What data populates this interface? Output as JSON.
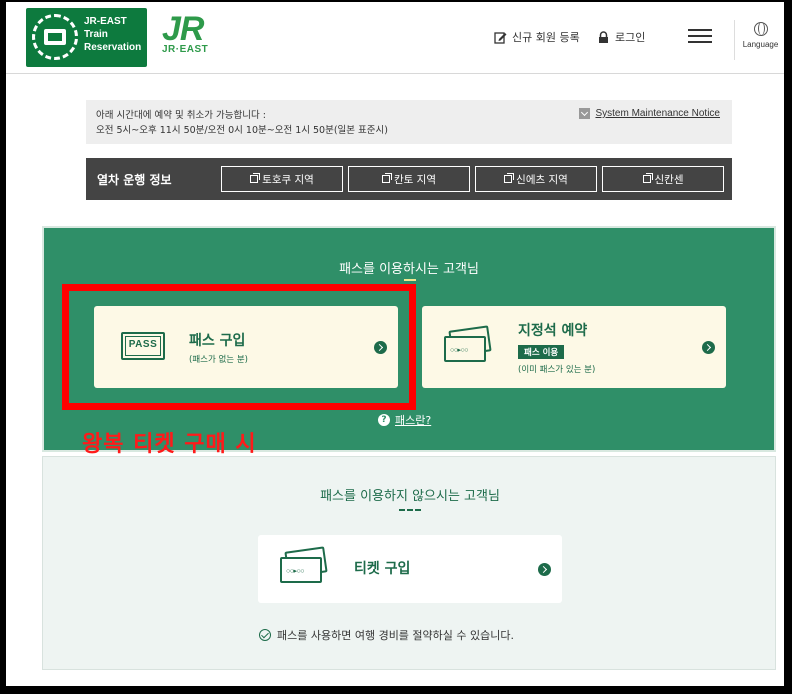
{
  "header": {
    "logo_line1": "JR-EAST",
    "logo_line2": "Train",
    "logo_line3": "Reservation",
    "jr_mark": "JR",
    "jr_sub": "JR·EAST",
    "register_label": "신규 회원 등록",
    "login_label": "로그인",
    "language_label": "Language"
  },
  "notice": {
    "line1": "아래 시간대에 예약 및 취소가 가능합니다 :",
    "line2": "오전 5시~오후 11시 50분/오전 0시 10분~오전 1시 50분(일본 표준시)",
    "maintenance_link": "System Maintenance Notice"
  },
  "train_info": {
    "title": "열차 운행 정보",
    "buttons": [
      "토호쿠 지역",
      "칸토 지역",
      "신에츠 지역",
      "신칸센"
    ]
  },
  "pass_section": {
    "title": "패스를 이용하시는 고객님",
    "buy": {
      "icon_text": "PASS",
      "title": "패스 구입",
      "subtitle": "(패스가 없는 분)"
    },
    "reserve": {
      "icon_text": "○○▸○○",
      "title": "지정석 예약",
      "badge": "패스 이용",
      "subtitle": "(이미 패스가 있는 분)"
    },
    "what_link": "패스란?"
  },
  "nopass_section": {
    "title": "패스를 이용하지 않으시는 고객님",
    "ticket": {
      "icon_text": "○○▸○○",
      "title": "티켓 구입"
    },
    "save_note": "패스를 사용하면 여행 경비를 절약하실 수 있습니다."
  },
  "annotation": {
    "text": "왕복 티켓 구매 시",
    "color": "#ff0000"
  },
  "colors": {
    "brand_green": "#0d7a3e",
    "section_green": "#2f8f68",
    "dark_green": "#1d6b4a",
    "bar_dark": "#444444"
  }
}
